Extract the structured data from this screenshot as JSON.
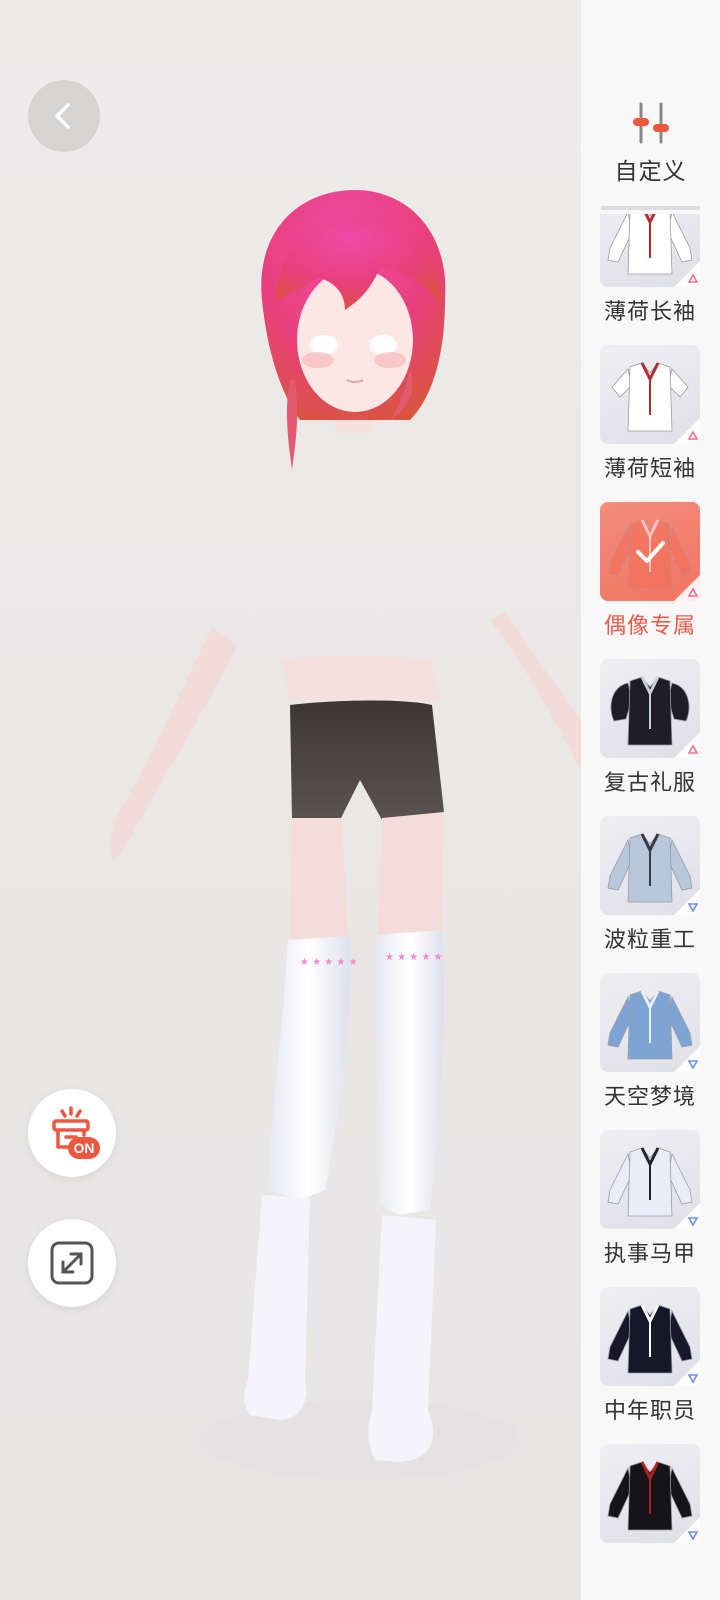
{
  "stage": {
    "colors": {
      "background": "#ebe9e8",
      "hair": "#e8407a",
      "skin": "#f7dcd8",
      "shorts": "#4a4443",
      "stockings": "#f4f2f8"
    },
    "back_icon": "chevron-left-icon",
    "wardrobe_icon": "wardrobe-on-icon",
    "wardrobe_badge": "ON",
    "fullscreen_icon": "expand-icon"
  },
  "panel": {
    "customize_icon": "sliders-icon",
    "customize_label": "自定义",
    "accent": "#ec5b48",
    "items": [
      {
        "label": "薄荷长袖",
        "icon": "long-sleeve-shirt-icon",
        "rarity": "pink",
        "selected": false
      },
      {
        "label": "薄荷短袖",
        "icon": "short-sleeve-shirt-icon",
        "rarity": "pink",
        "selected": false
      },
      {
        "label": "偶像专属",
        "icon": "idol-jacket-icon",
        "rarity": "pink",
        "selected": true
      },
      {
        "label": "复古礼服",
        "icon": "retro-dress-top-icon",
        "rarity": "pink",
        "selected": false
      },
      {
        "label": "波粒重工",
        "icon": "hooded-jacket-icon",
        "rarity": "blue",
        "selected": false
      },
      {
        "label": "天空梦境",
        "icon": "sky-hoodie-icon",
        "rarity": "blue",
        "selected": false
      },
      {
        "label": "执事马甲",
        "icon": "butler-vest-icon",
        "rarity": "blue",
        "selected": false
      },
      {
        "label": "中年职员",
        "icon": "suit-jacket-icon",
        "rarity": "blue",
        "selected": false
      },
      {
        "label": "",
        "icon": "black-suit-icon",
        "rarity": "blue",
        "selected": false
      }
    ]
  }
}
